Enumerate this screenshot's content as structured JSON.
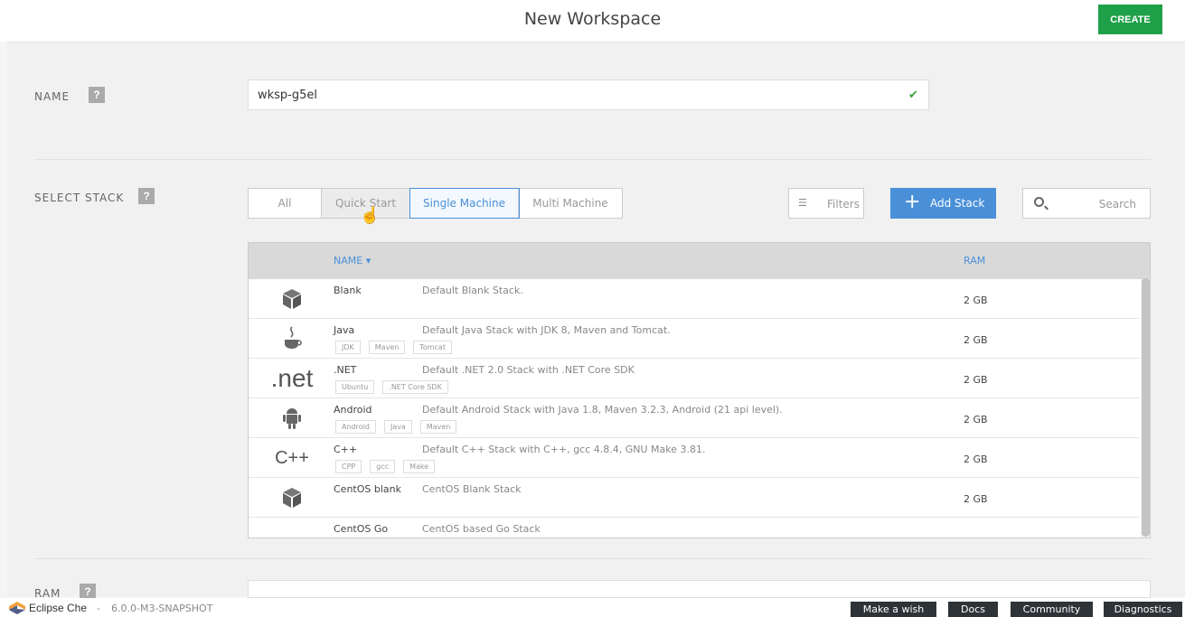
{
  "header": {
    "title": "New Workspace",
    "create_label": "CREATE"
  },
  "name_section": {
    "label": "NAME",
    "help": "?",
    "value": "wksp-g5el",
    "valid_icon": "check-icon"
  },
  "stack_section": {
    "label": "SELECT STACK",
    "help": "?",
    "tabs": [
      {
        "label": "All"
      },
      {
        "label": "Quick Start"
      },
      {
        "label": "Single Machine"
      },
      {
        "label": "Multi Machine"
      }
    ],
    "active_tab": "Single Machine",
    "filters_label": "Filters",
    "add_stack_label": "Add Stack",
    "search_placeholder": "Search"
  },
  "table": {
    "columns": {
      "name": "NAME",
      "ram": "RAM"
    },
    "sort_indicator": "▾",
    "rows": [
      {
        "icon": "cube-icon",
        "name": "Blank",
        "description": "Default Blank Stack.",
        "tags": [],
        "ram": "2 GB"
      },
      {
        "icon": "java-icon",
        "name": "Java",
        "description": "Default Java Stack with JDK 8, Maven and Tomcat.",
        "tags": [
          "JDK",
          "Maven",
          "Tomcat"
        ],
        "ram": "2 GB"
      },
      {
        "icon": "dotnet-icon",
        "icon_text": ".net",
        "name": ".NET",
        "description": "Default .NET 2.0 Stack with .NET Core SDK",
        "tags": [
          "Ubuntu",
          ".NET Core SDK"
        ],
        "ram": "2 GB"
      },
      {
        "icon": "android-icon",
        "name": "Android",
        "description": "Default Android Stack with Java 1.8, Maven 3.2.3, Android (21 api level).",
        "tags": [
          "Android",
          "Java",
          "Maven"
        ],
        "ram": "2 GB"
      },
      {
        "icon": "cpp-icon",
        "icon_text": "C++",
        "name": "C++",
        "description": "Default C++ Stack with C++, gcc 4.8.4, GNU Make 3.81.",
        "tags": [
          "CPP",
          "gcc",
          "Make"
        ],
        "ram": "2 GB"
      },
      {
        "icon": "cube-icon",
        "name": "CentOS blank",
        "description": "CentOS Blank Stack",
        "tags": [],
        "ram": "2 GB"
      },
      {
        "icon": "go-icon",
        "name": "CentOS Go",
        "description": "CentOS based Go Stack",
        "tags": [],
        "ram": ""
      }
    ]
  },
  "ram_section": {
    "label": "RAM",
    "help": "?"
  },
  "footer": {
    "brand": "Eclipse Che",
    "separator": "-",
    "version": "6.0.0-M3-SNAPSHOT",
    "links": [
      "Make a wish",
      "Docs",
      "Community",
      "Diagnostics"
    ]
  },
  "colors": {
    "create": "#1ea048",
    "accent": "#4a90d9",
    "footer_btn": "#2e3338",
    "check": "#3aa53a"
  }
}
